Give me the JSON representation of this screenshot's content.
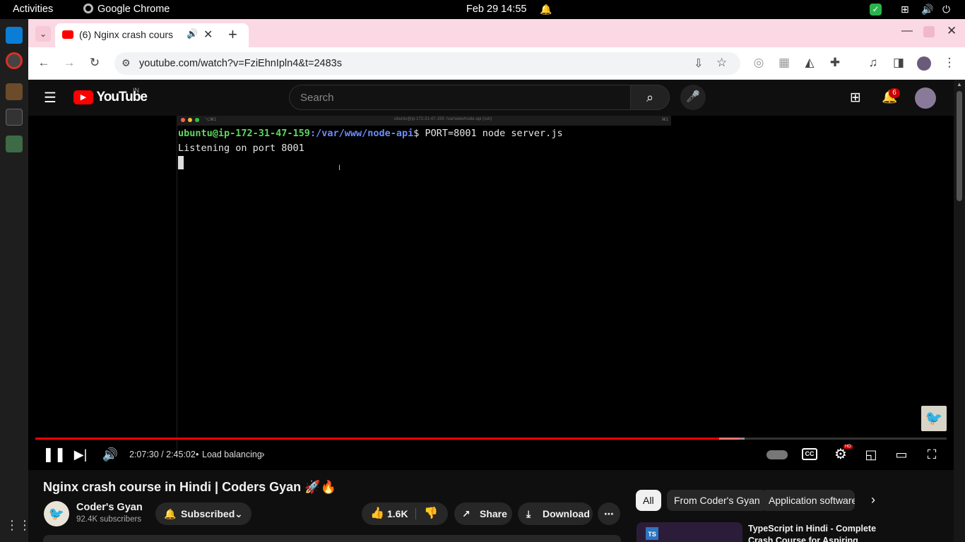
{
  "topbar": {
    "activities": "Activities",
    "app": "Google Chrome",
    "datetime": "Feb 29  14:55"
  },
  "browser": {
    "tab_title": "(6) Nginx crash cours",
    "url": "youtube.com/watch?v=FziEhnIpln4&t=2483s"
  },
  "youtube": {
    "logo_text": "YouTube",
    "region": "IN",
    "search_placeholder": "Search",
    "notification_count": "6"
  },
  "terminal": {
    "title_left": "⌥⌘1",
    "title_center": "ubuntu@ip-172-31-47-159: /var/www/node-api (ssh)",
    "title_right": "⌘1",
    "prompt_user": "ubuntu@ip-172-31-47-159",
    "prompt_path": ":/var/www/node-api",
    "command": "$ PORT=8001 node server.js",
    "output": "Listening on port 8001"
  },
  "player": {
    "time": "2:07:30 / 2:45:02",
    "chapter": "Load balancing",
    "progress_fraction": 0.772
  },
  "video": {
    "title": "Nginx crash course in Hindi | Coders Gyan 🚀🔥",
    "channel": "Coder's Gyan",
    "subscribers": "92.4K subscribers",
    "subscribed_label": "Subscribed",
    "likes": "1.6K",
    "share_label": "Share",
    "download_label": "Download"
  },
  "chips": [
    "All",
    "From Coder's Gyan",
    "Application software"
  ],
  "suggestion": {
    "title": "TypeScript in Hindi - Complete Crash Course for Aspiring",
    "badge": "TS"
  },
  "colors": {
    "progress_red": "#ff0000",
    "prompt_green": "#5fd75f",
    "prompt_blue": "#6b8cff",
    "tab_bar_pink": "#fbd9e4"
  }
}
